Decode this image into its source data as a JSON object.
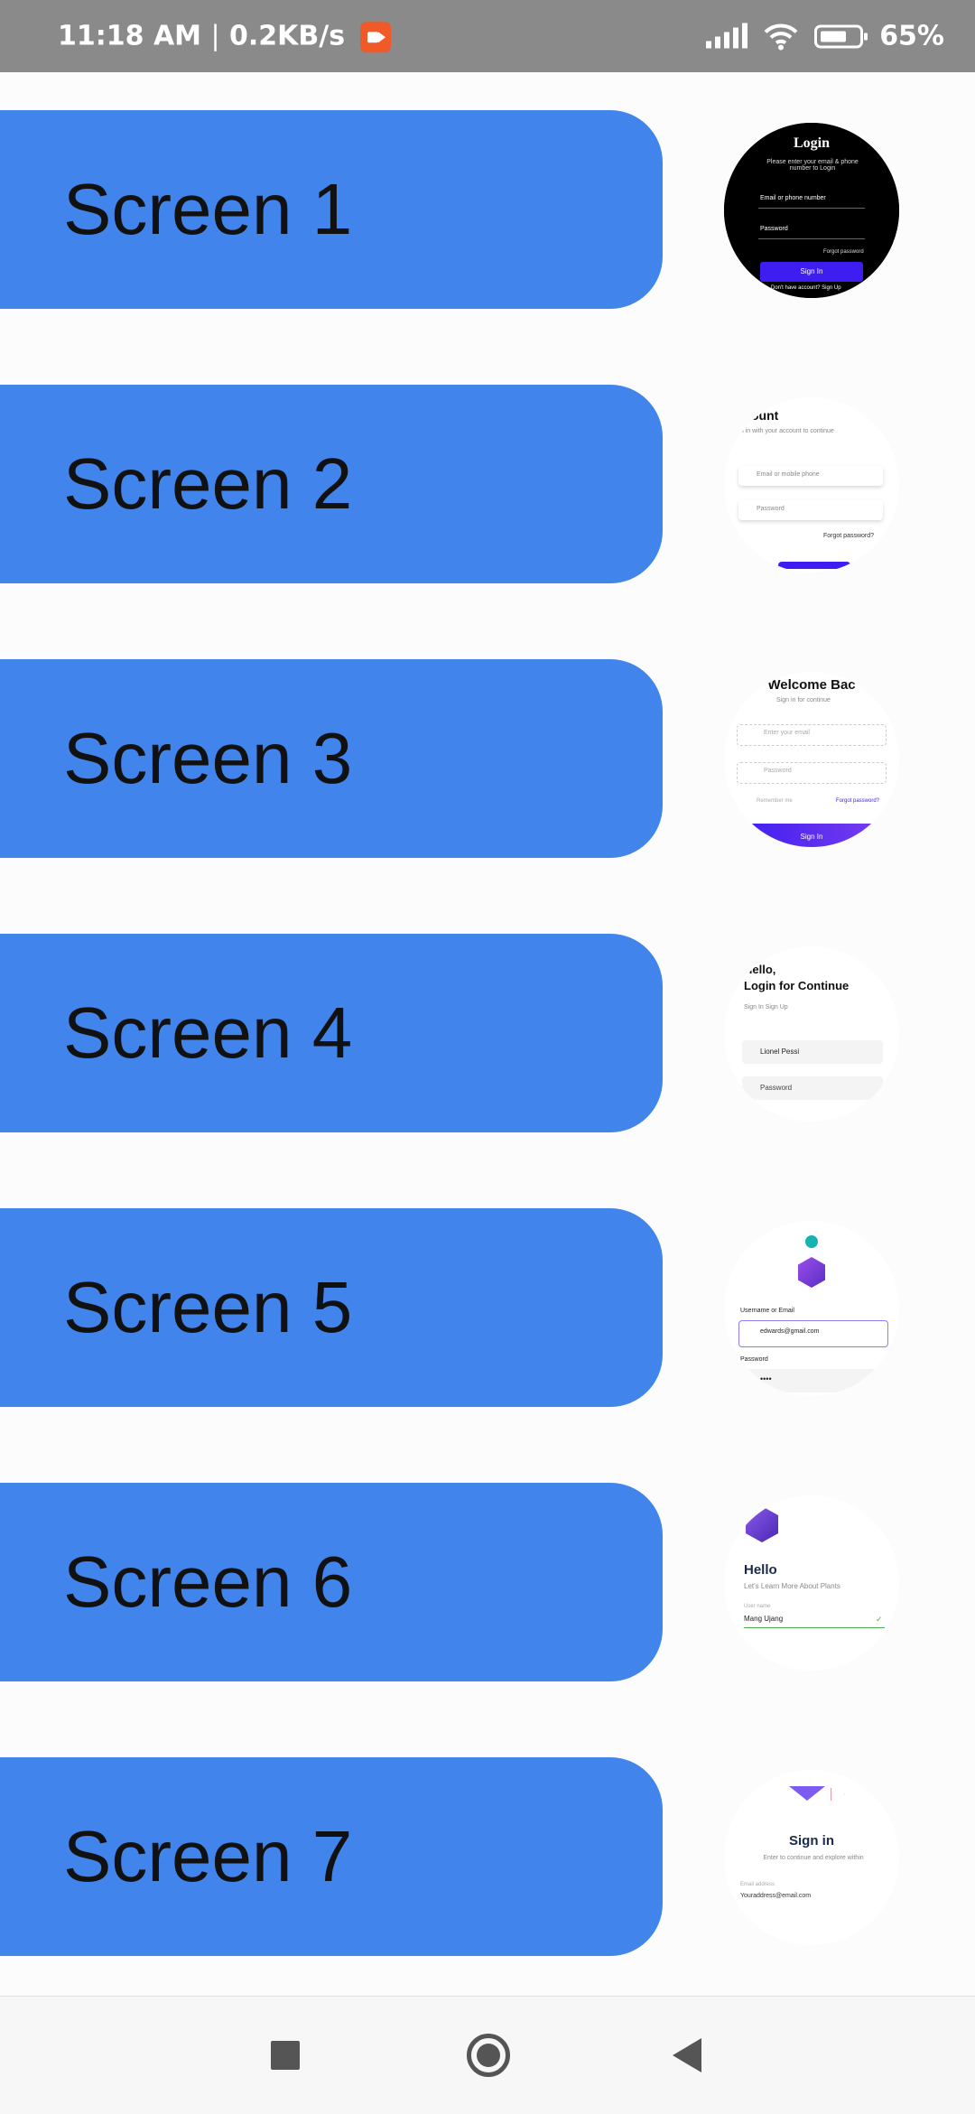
{
  "status_bar": {
    "time": "11:18 AM",
    "separator": "|",
    "speed": "0.2KB/s",
    "battery_percent": "65%"
  },
  "screens": [
    {
      "label": "Screen 1"
    },
    {
      "label": "Screen 2"
    },
    {
      "label": "Screen 3"
    },
    {
      "label": "Screen 4"
    },
    {
      "label": "Screen 5"
    },
    {
      "label": "Screen 6"
    },
    {
      "label": "Screen 7"
    }
  ],
  "thumbs": {
    "t1": {
      "title": "Login",
      "subtitle": "Please enter your email & phone number to Login",
      "field1": "Email or phone number",
      "field2": "Password",
      "forgot": "Forgot password",
      "button": "Sign In",
      "footer": "Don't have account? Sign Up"
    },
    "t2": {
      "title": "ount",
      "subtitle": "gn in with your account to continue",
      "field1": "Email or mobile phone",
      "field2": "Password",
      "forgot": "Forgot password?"
    },
    "t3": {
      "title": "Welcome Bac",
      "subtitle": "Sign in for continue",
      "field1": "Enter your email",
      "field2": "Password",
      "remember": "Remember me",
      "forgot": "Forgot password?",
      "button": "Sign In"
    },
    "t4": {
      "title_line1": "Hello,",
      "title_line2": "Login for Continue",
      "tabs": "Sign In  Sign Up",
      "field1": "Lionel Pessi",
      "field2": "Password"
    },
    "t5": {
      "label1": "Username or Email",
      "field1": "edwards@gmail.com",
      "label2": "Password",
      "field2": "••••"
    },
    "t6": {
      "title": "Hello",
      "subtitle": "Let's Learn More About Plants",
      "label": "User name",
      "field": "Mang Ujang"
    },
    "t7": {
      "title": "Sign in",
      "subtitle": "Enter to continue and explore within",
      "label": "Email address",
      "field": "Youraddress@email.com"
    }
  },
  "colors": {
    "button_bg": "#4184ec",
    "status_bar_bg": "#8a8a8a",
    "accent_purple": "#3d1df0"
  },
  "icons": [
    "screen-record-icon",
    "signal-icon",
    "wifi-icon",
    "battery-icon",
    "recents-square-icon",
    "home-circle-icon",
    "back-triangle-icon"
  ]
}
